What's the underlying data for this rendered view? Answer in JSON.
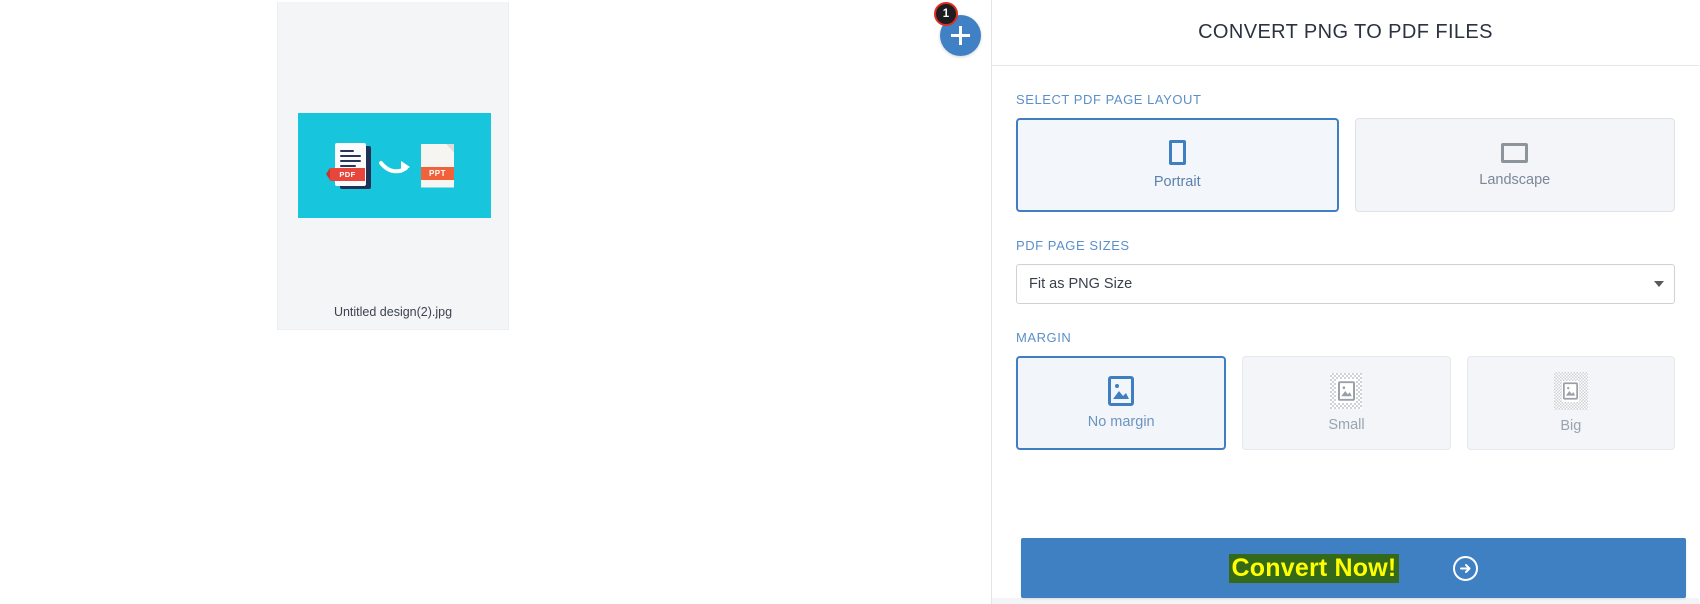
{
  "canvas": {
    "file_card": {
      "file_name": "Untitled design(2).jpg",
      "thumbnail": {
        "background_color": "#17c5dd",
        "left_icon_label": "PDF",
        "right_icon_label": "PPT",
        "arrow_icon": "curved-arrow-right-icon"
      }
    },
    "add_files_button": {
      "icon": "plus-icon",
      "badge_count": "1",
      "color": "#3f81c4",
      "badge_border_color": "#e02b20"
    }
  },
  "panel": {
    "title": "CONVERT PNG TO PDF FILES",
    "layout_section": {
      "label": "SELECT PDF PAGE LAYOUT",
      "options": [
        {
          "label": "Portrait",
          "icon": "portrait-page-icon",
          "selected": true
        },
        {
          "label": "Landscape",
          "icon": "landscape-page-icon",
          "selected": false
        }
      ]
    },
    "page_size_section": {
      "label": "PDF PAGE SIZES",
      "selected_value": "Fit as PNG Size",
      "caret_icon": "chevron-down-icon"
    },
    "margin_section": {
      "label": "MARGIN",
      "options": [
        {
          "label": "No margin",
          "icon": "image-icon",
          "selected": true
        },
        {
          "label": "Small",
          "icon": "image-icon-small-margin",
          "selected": false
        },
        {
          "label": "Big",
          "icon": "image-icon-big-margin",
          "selected": false
        }
      ]
    },
    "convert_button": {
      "label": "Convert Now!",
      "text_color": "#ffff00",
      "highlight_color": "#35691a",
      "background_color": "#3f80c3",
      "icon": "arrow-right-circle-icon"
    }
  }
}
